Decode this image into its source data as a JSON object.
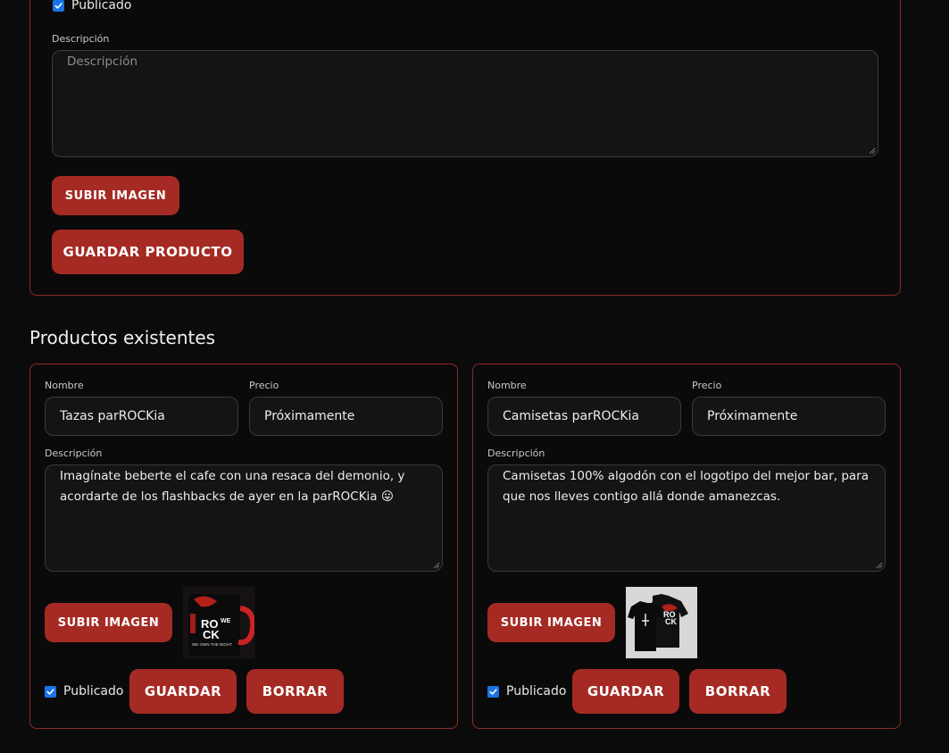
{
  "new_product": {
    "published_label": "Publicado",
    "description_label": "Descripción",
    "description_placeholder": "Descripción",
    "upload_label": "SUBIR IMAGEN",
    "save_label": "GUARDAR PRODUCTO"
  },
  "existing": {
    "title": "Productos existentes",
    "products": [
      {
        "name_label": "Nombre",
        "name": "Tazas parROCKia",
        "price_label": "Precio",
        "price": "Próximamente",
        "description_label": "Descripción",
        "description": "Imagínate beberte el cafe con una resaca del demonio, y acordarte de los flashbacks de ayer en la parROCKia 😛",
        "upload_label": "SUBIR IMAGEN",
        "published_label": "Publicado",
        "save_label": "GUARDAR",
        "delete_label": "BORRAR",
        "image_text": {
          "top": "RO",
          "bottom": "CK",
          "side": "WE",
          "tagline": "WE OWN THE NIGHT"
        }
      },
      {
        "name_label": "Nombre",
        "name": "Camisetas parROCKia",
        "price_label": "Precio",
        "price": "Próximamente",
        "description_label": "Descripción",
        "description": "Camisetas 100% algodón con el logotipo del mejor bar, para que nos lleves contigo allá donde amanezcas.",
        "upload_label": "SUBIR IMAGEN",
        "published_label": "Publicado",
        "save_label": "GUARDAR",
        "delete_label": "BORRAR",
        "image_text": {
          "top": "RO",
          "bottom": "CK"
        }
      }
    ]
  },
  "colors": {
    "accent": "#a52a24",
    "border": "#8e2a24",
    "background": "#0a0a0b",
    "field": "#141415",
    "checkbox": "#1a73e8"
  }
}
